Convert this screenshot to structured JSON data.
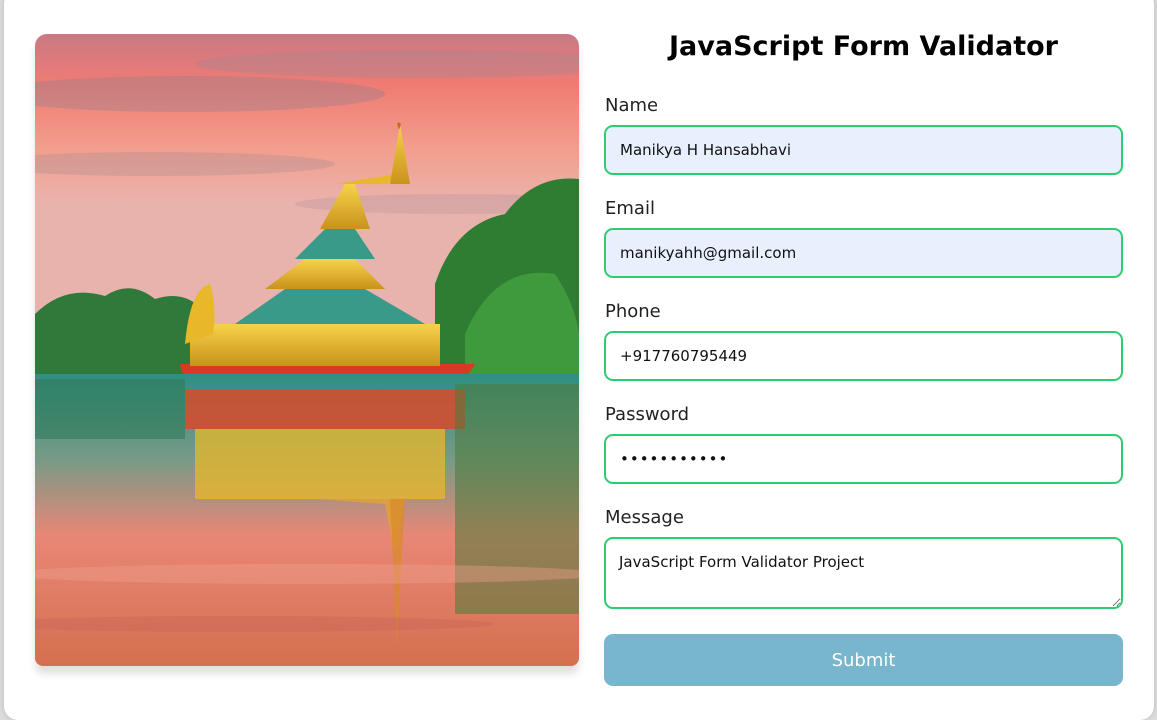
{
  "form": {
    "title": "JavaScript Form Validator",
    "fields": {
      "name": {
        "label": "Name",
        "value": "Manikya H Hansabhavi"
      },
      "email": {
        "label": "Email",
        "value": "manikyahh@gmail.com"
      },
      "phone": {
        "label": "Phone",
        "value": "+917760795449"
      },
      "password": {
        "label": "Password",
        "value": "•••••••••••"
      },
      "message": {
        "label": "Message",
        "value": "JavaScript Form Validator Project"
      }
    },
    "submit_label": "Submit"
  },
  "image": {
    "description": "pagoda-lake-sunset"
  },
  "colors": {
    "valid_border": "#2ecc71",
    "submit_bg": "#77b6cc",
    "autofill_bg": "#e8f0fe"
  }
}
